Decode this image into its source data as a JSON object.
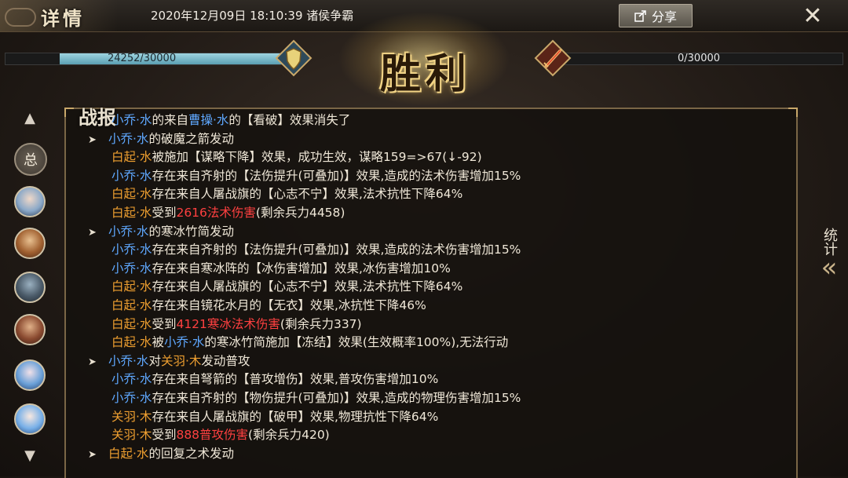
{
  "header": {
    "title": "详情",
    "datetime": "2020年12月09日 18:10:39 诸侯争霸",
    "share_label": "分享",
    "close_icon": "close-icon"
  },
  "battle": {
    "left_hp_text": "24252/30000",
    "left_hp_fraction": 0.8084,
    "right_hp_text": "0/30000",
    "right_hp_fraction": 0,
    "result": "胜利"
  },
  "sidebar": {
    "total_label": "总",
    "avatars": [
      "avatar-1",
      "avatar-2",
      "avatar-3",
      "avatar-4",
      "avatar-5",
      "avatar-6"
    ]
  },
  "stats": {
    "label": "统计"
  },
  "log": {
    "label": "战报",
    "lines": [
      {
        "indent": 1,
        "segs": [
          {
            "t": "小乔·水",
            "c": "#5fa8ff"
          },
          {
            "t": "的来自"
          },
          {
            "t": "曹操·水",
            "c": "#5fa8ff"
          },
          {
            "t": "的【看破】效果消失了"
          }
        ]
      },
      {
        "indent": 0,
        "segs": [
          {
            "t": "小乔·水",
            "c": "#5fa8ff"
          },
          {
            "t": "的破魔之箭发动"
          }
        ]
      },
      {
        "indent": 1,
        "segs": [
          {
            "t": "白起·水",
            "c": "#f0a030"
          },
          {
            "t": "被施加【谋略下降】效果，成功生效，谋略159=>67(↓-92)"
          }
        ]
      },
      {
        "indent": 1,
        "segs": [
          {
            "t": "小乔·水",
            "c": "#5fa8ff"
          },
          {
            "t": "存在来自齐射的【法伤提升(可叠加)】效果,造成的法术伤害增加15%"
          }
        ]
      },
      {
        "indent": 1,
        "segs": [
          {
            "t": "白起·水",
            "c": "#f0a030"
          },
          {
            "t": "存在来自人屠战旗的【心志不宁】效果,法术抗性下降64%"
          }
        ]
      },
      {
        "indent": 1,
        "segs": [
          {
            "t": "白起·水",
            "c": "#f0a030"
          },
          {
            "t": "受到"
          },
          {
            "t": "2616法术伤害",
            "c": "#ff4040"
          },
          {
            "t": "(剩余兵力4458)"
          }
        ]
      },
      {
        "indent": 0,
        "segs": [
          {
            "t": "小乔·水",
            "c": "#5fa8ff"
          },
          {
            "t": "的寒冰竹简发动"
          }
        ]
      },
      {
        "indent": 1,
        "segs": [
          {
            "t": "小乔·水",
            "c": "#5fa8ff"
          },
          {
            "t": "存在来自齐射的【法伤提升(可叠加)】效果,造成的法术伤害增加15%"
          }
        ]
      },
      {
        "indent": 1,
        "segs": [
          {
            "t": "小乔·水",
            "c": "#5fa8ff"
          },
          {
            "t": "存在来自寒冰阵的【冰伤害增加】效果,冰伤害增加10%"
          }
        ]
      },
      {
        "indent": 1,
        "segs": [
          {
            "t": "白起·水",
            "c": "#f0a030"
          },
          {
            "t": "存在来自人屠战旗的【心志不宁】效果,法术抗性下降64%"
          }
        ]
      },
      {
        "indent": 1,
        "segs": [
          {
            "t": "白起·水",
            "c": "#f0a030"
          },
          {
            "t": "存在来自镜花水月的【无衣】效果,冰抗性下降46%"
          }
        ]
      },
      {
        "indent": 1,
        "segs": [
          {
            "t": "白起·水",
            "c": "#f0a030"
          },
          {
            "t": "受到"
          },
          {
            "t": "4121寒冰法术伤害",
            "c": "#ff4040"
          },
          {
            "t": "(剩余兵力337)"
          }
        ]
      },
      {
        "indent": 1,
        "segs": [
          {
            "t": "白起·水",
            "c": "#f0a030"
          },
          {
            "t": "被"
          },
          {
            "t": "小乔·水",
            "c": "#5fa8ff"
          },
          {
            "t": "的寒冰竹简施加【冻结】效果(生效概率100%),无法行动"
          }
        ]
      },
      {
        "indent": 0,
        "segs": [
          {
            "t": "小乔·水",
            "c": "#5fa8ff"
          },
          {
            "t": "对"
          },
          {
            "t": "关羽·木",
            "c": "#f0a030"
          },
          {
            "t": "发动普攻"
          }
        ]
      },
      {
        "indent": 1,
        "segs": [
          {
            "t": "小乔·水",
            "c": "#5fa8ff"
          },
          {
            "t": "存在来自弩箭的【普攻增伤】效果,普攻伤害增加10%"
          }
        ]
      },
      {
        "indent": 1,
        "segs": [
          {
            "t": "小乔·水",
            "c": "#5fa8ff"
          },
          {
            "t": "存在来自齐射的【物伤提升(可叠加)】效果,造成的物理伤害增加15%"
          }
        ]
      },
      {
        "indent": 1,
        "segs": [
          {
            "t": "关羽·木",
            "c": "#f0a030"
          },
          {
            "t": "存在来自人屠战旗的【破甲】效果,物理抗性下降64%"
          }
        ]
      },
      {
        "indent": 1,
        "segs": [
          {
            "t": "关羽·木",
            "c": "#f0a030"
          },
          {
            "t": "受到"
          },
          {
            "t": "888普攻伤害",
            "c": "#ff4040"
          },
          {
            "t": "(剩余兵力420)"
          }
        ]
      },
      {
        "indent": 0,
        "segs": [
          {
            "t": "白起·水",
            "c": "#f0a030"
          },
          {
            "t": "的回复之术发动"
          }
        ]
      }
    ]
  }
}
